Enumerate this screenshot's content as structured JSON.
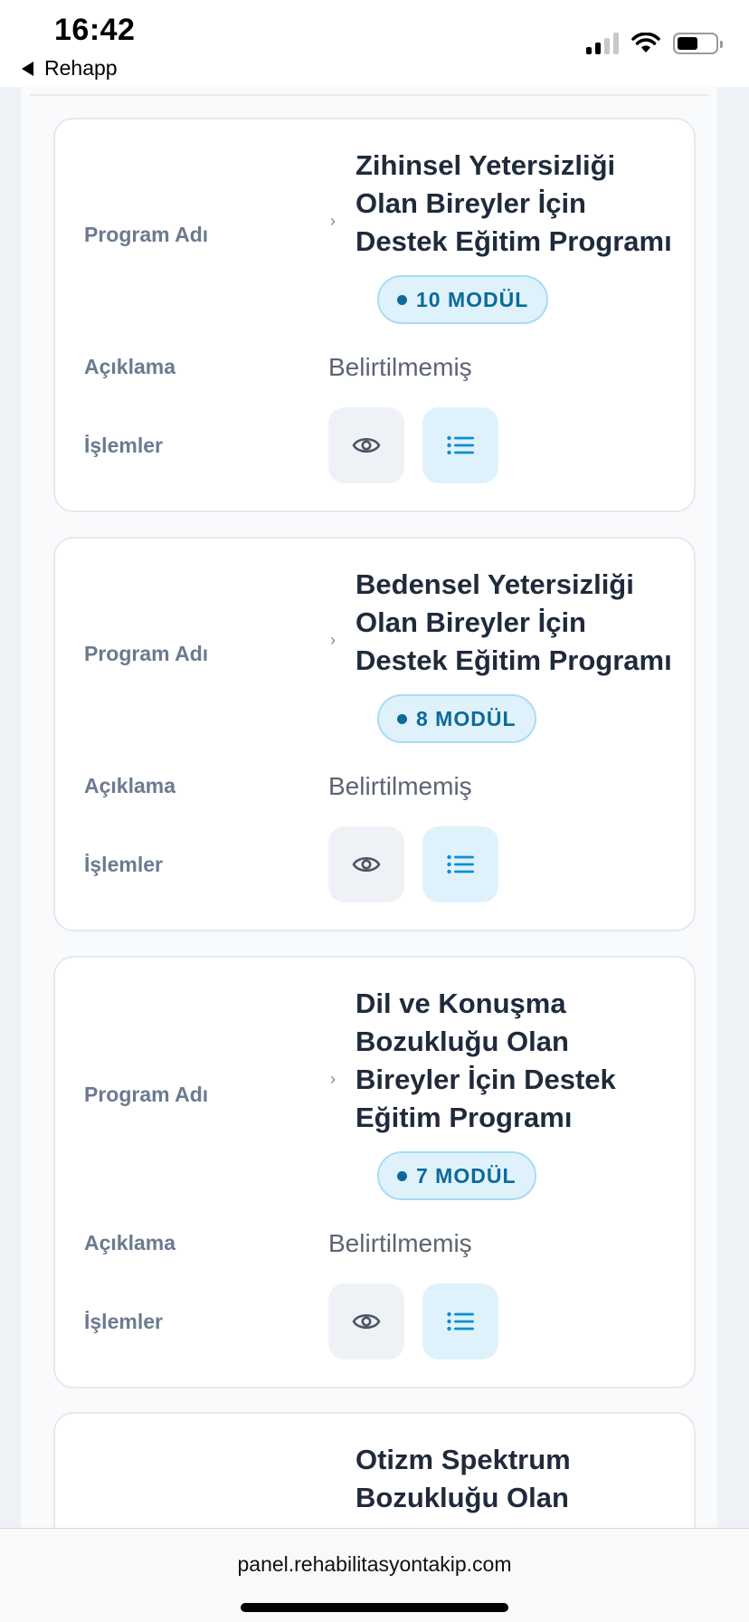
{
  "status_bar": {
    "time": "16:42",
    "back_app": "Rehapp",
    "icons": [
      "signal-icon",
      "wifi-icon",
      "battery-icon"
    ]
  },
  "labels": {
    "program_name": "Program Adı",
    "description": "Açıklama",
    "actions": "İşlemler"
  },
  "programs": [
    {
      "title": "Zihinsel Yetersizliği Olan Bireyler İçin Destek Eğitim Programı",
      "modules": "10 MODÜL",
      "description": "Belirtilmemiş"
    },
    {
      "title": "Bedensel Yetersizliği Olan Bireyler İçin Destek Eğitim Programı",
      "modules": "8 MODÜL",
      "description": "Belirtilmemiş"
    },
    {
      "title": "Dil ve Konuşma Bozukluğu Olan Bireyler İçin Destek Eğitim Programı",
      "modules": "7 MODÜL",
      "description": "Belirtilmemiş"
    },
    {
      "title": "Otizm Spektrum Bozukluğu Olan"
    }
  ],
  "browser": {
    "url": "panel.rehabilitasyontakip.com"
  },
  "colors": {
    "badge_bg": "#dff2fc",
    "badge_text": "#0c6a9a",
    "label": "#6b7a90",
    "title": "#1f2a3c"
  }
}
